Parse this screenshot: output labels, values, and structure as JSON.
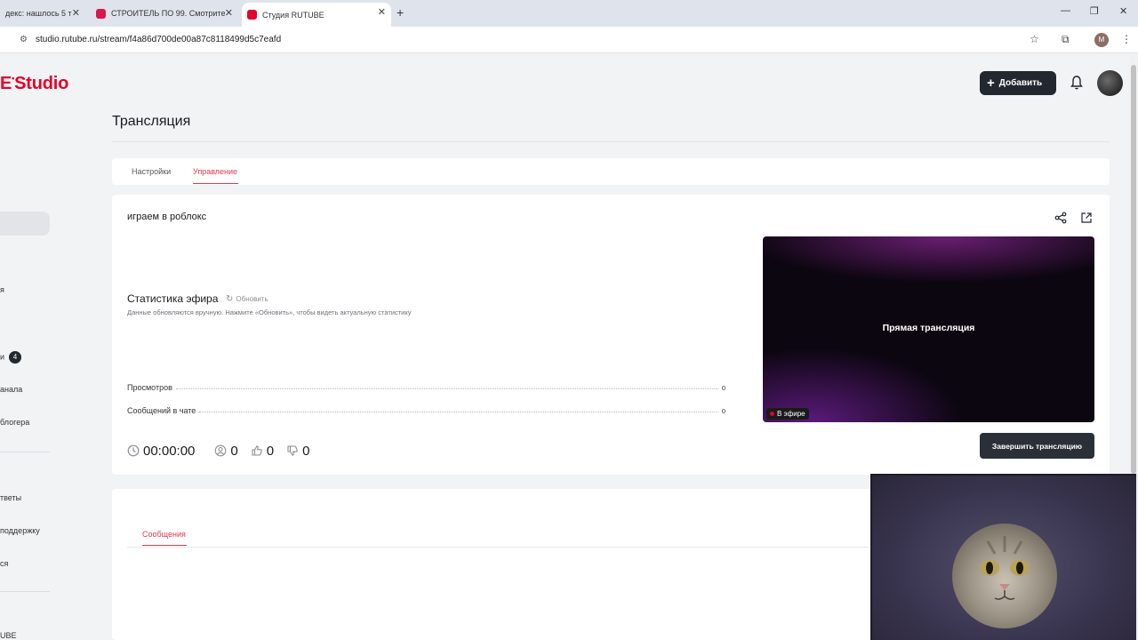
{
  "browser": {
    "tabs": [
      {
        "title": "декс: нашлось 5 т"
      },
      {
        "title": "СТРОИТЕЛЬ ПО 99. Смотрите"
      },
      {
        "title": "Студия RUTUBE"
      }
    ],
    "url": "studio.rutube.ru/stream/f4a86d700de00a87c8118499d5c7eafd",
    "profile_initial": "M",
    "new_tab": "+",
    "win_minimize": "—",
    "win_restore": "❐",
    "win_close": "✕"
  },
  "header": {
    "logo_mark": "E",
    "logo_text": "Studio",
    "add_label": "Добавить"
  },
  "sidebar": {
    "items": [
      {
        "label": "я"
      },
      {
        "label": "и",
        "badge": "4"
      },
      {
        "label": "анала"
      },
      {
        "label": "блогера"
      },
      {
        "label": "тветы"
      },
      {
        "label": "поддержку"
      },
      {
        "label": "ся"
      },
      {
        "label": "UBE"
      }
    ]
  },
  "page": {
    "title": "Трансляция",
    "tabs": [
      {
        "label": "Настройки"
      },
      {
        "label": "Управление"
      }
    ]
  },
  "stream": {
    "name": "играем в роблокс",
    "stats_title": "Статистика эфира",
    "refresh_label": "Обновить",
    "stats_note": "Данные обновляются вручную. Нажмите «Обновить», чтобы видеть актуальную статистику",
    "stats": [
      {
        "label": "Просмотров",
        "value": "0"
      },
      {
        "label": "Сообщений в чате",
        "value": "0"
      }
    ],
    "preview_text": "Прямая трансляция",
    "live_label": "В эфире",
    "duration": "00:00:00",
    "viewers": "0",
    "likes": "0",
    "dislikes": "0",
    "end_label": "Завершить трансляцию"
  },
  "chat": {
    "tab_label": "Сообщения"
  },
  "colors": {
    "accent": "#e4374b",
    "brand": "#e4002b",
    "dark_button": "#23272f"
  }
}
